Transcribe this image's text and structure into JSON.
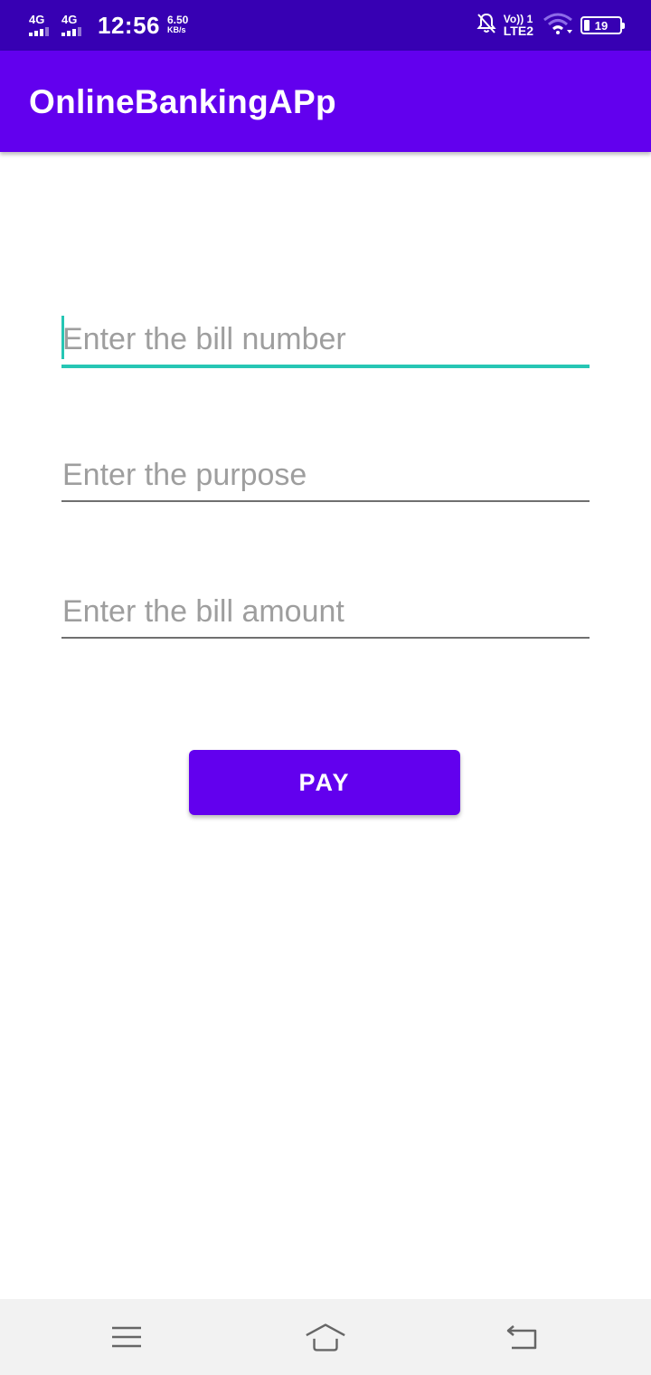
{
  "status_bar": {
    "network1": "4G",
    "network2": "4G",
    "time": "12:56",
    "speed_value": "6.50",
    "speed_unit": "KB/s",
    "volte_top": "Vo)) 1",
    "volte_bottom": "LTE2",
    "battery": "19"
  },
  "app_bar": {
    "title": "OnlineBankingAPp"
  },
  "form": {
    "bill_number_placeholder": "Enter the bill number",
    "purpose_placeholder": "Enter the purpose",
    "amount_placeholder": "Enter the bill amount",
    "pay_label": "PAY"
  },
  "colors": {
    "status_bar": "#3700b3",
    "primary": "#6200ee",
    "focus_accent": "#26c6b4"
  },
  "nav_bar": {
    "icons": [
      "menu-icon",
      "home-icon",
      "back-icon"
    ]
  }
}
